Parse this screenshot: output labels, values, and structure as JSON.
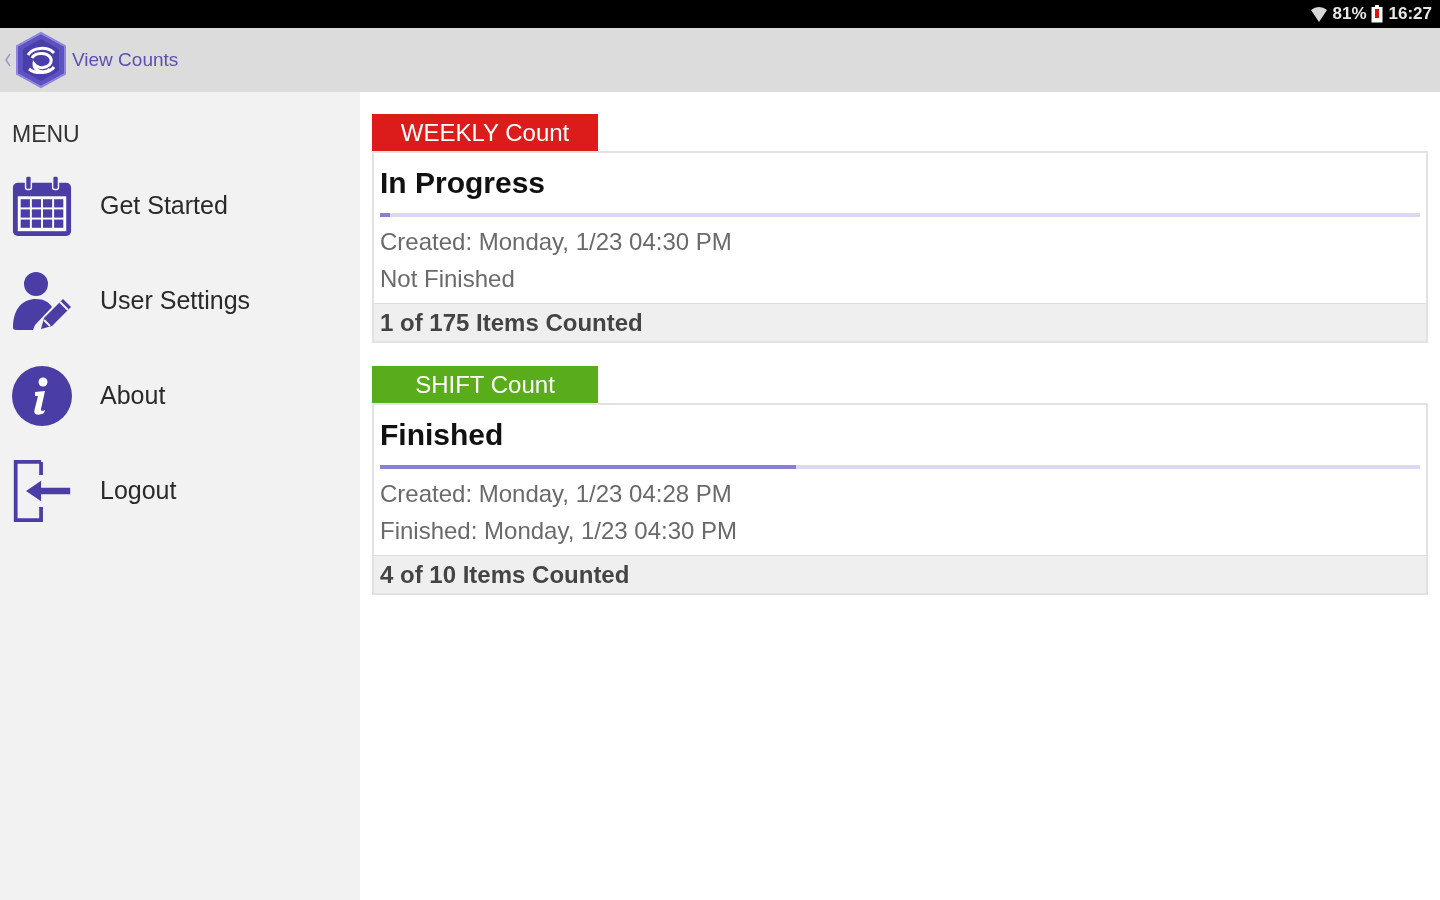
{
  "status_bar": {
    "battery_percent": "81%",
    "time": "16:27"
  },
  "app_bar": {
    "title": "View Counts"
  },
  "sidebar": {
    "heading": "MENU",
    "items": [
      {
        "label": "Get Started",
        "kind": "calendar"
      },
      {
        "label": "User Settings",
        "kind": "user"
      },
      {
        "label": "About",
        "kind": "info"
      },
      {
        "label": "Logout",
        "kind": "exit"
      }
    ]
  },
  "counts": [
    {
      "tag": "WEEKLY Count",
      "color": "#dc1b1b",
      "status": "In Progress",
      "level": 0.01,
      "lines": [
        "Created: Monday, 1/23 04:30 PM",
        "Not Finished"
      ],
      "footer": "1 of 175 Items Counted"
    },
    {
      "tag": "SHIFT Count",
      "color": "#5aad1a",
      "status": "Finished",
      "level": 0.4,
      "lines": [
        "Created: Monday, 1/23 04:28 PM",
        "Finished: Monday, 1/23 04:30 PM"
      ],
      "footer": "4 of 10 Items Counted"
    }
  ]
}
